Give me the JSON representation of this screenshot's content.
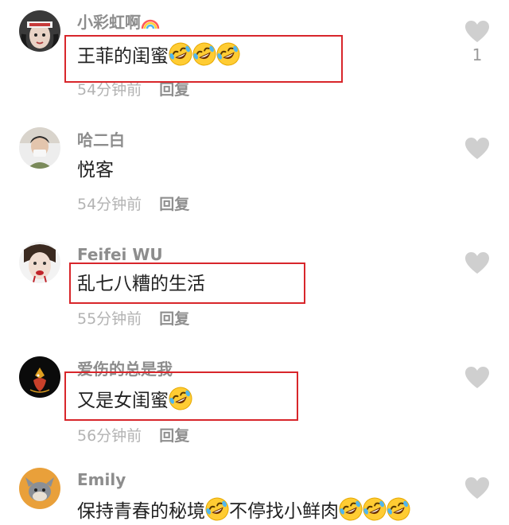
{
  "comments": [
    {
      "username": "小彩虹啊",
      "username_icon": "rainbow-icon",
      "text": "王菲的闺蜜",
      "emoji": "rolling-on-floor-laughing-icon",
      "emoji_count": 3,
      "time": "54分钟前",
      "reply_label": "回复",
      "likes": "1",
      "highlighted": true
    },
    {
      "username": "哈二白",
      "text": "悦客",
      "time": "54分钟前",
      "reply_label": "回复",
      "highlighted": false
    },
    {
      "username": "Feifei WU",
      "text": "乱七八糟的生活",
      "time": "55分钟前",
      "reply_label": "回复",
      "highlighted": true
    },
    {
      "username": "爱伤的总是我",
      "text": "又是女闺蜜",
      "emoji": "rolling-on-floor-laughing-icon",
      "emoji_count": 1,
      "time": "56分钟前",
      "reply_label": "回复",
      "highlighted": true
    },
    {
      "username": "Emily",
      "text_part1": "保持青春的秘境",
      "text_part2": "不停找小鲜肉",
      "emoji": "rolling-on-floor-laughing-icon",
      "time": "",
      "highlighted": false
    }
  ],
  "colors": {
    "highlight_box": "#d8262b",
    "username": "#8d8d8d",
    "comment_text": "#222222",
    "meta_text": "#b3b3b3",
    "heart": "#cfcfcf"
  }
}
